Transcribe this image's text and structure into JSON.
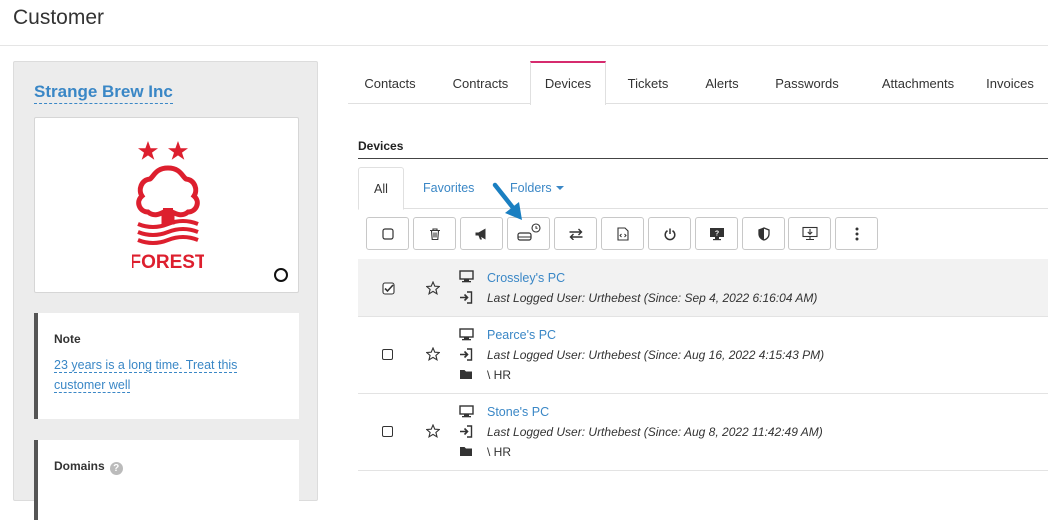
{
  "page": {
    "title": "Customer"
  },
  "customer": {
    "name": "Strange Brew Inc",
    "note": {
      "title": "Note",
      "text": "23 years is a long time. Treat this customer well"
    },
    "domains": {
      "title": "Domains"
    }
  },
  "tabs": [
    {
      "label": "Contacts"
    },
    {
      "label": "Contracts"
    },
    {
      "label": "Devices",
      "active": true
    },
    {
      "label": "Tickets"
    },
    {
      "label": "Alerts"
    },
    {
      "label": "Passwords"
    },
    {
      "label": "Attachments"
    },
    {
      "label": "Invoices"
    }
  ],
  "devices": {
    "title": "Devices",
    "subtabs": {
      "all": "All",
      "favorites": "Favorites",
      "folders": "Folders"
    },
    "toolbar": [
      "select-all",
      "delete",
      "announce",
      "drive-clock",
      "transfer",
      "script",
      "power",
      "remote-help",
      "shield",
      "download"
    ],
    "rows": [
      {
        "name": "Crossley's PC",
        "user": "Last Logged User: Urthebest (Since: Sep 4, 2022 6:16:04 AM)",
        "folder": "",
        "checked": true
      },
      {
        "name": "Pearce's PC",
        "user": "Last Logged User: Urthebest (Since: Aug 16, 2022 4:15:43 PM)",
        "folder": "\\ HR",
        "checked": false
      },
      {
        "name": "Stone's PC",
        "user": "Last Logged User: Urthebest (Since: Aug 8, 2022 11:42:49 AM)",
        "folder": "\\ HR",
        "checked": false
      }
    ]
  },
  "colors": {
    "link": "#3a87c6",
    "active_tab": "#d62b6e",
    "logo": "#dd1f2e",
    "annotation": "#1a7fc1"
  }
}
